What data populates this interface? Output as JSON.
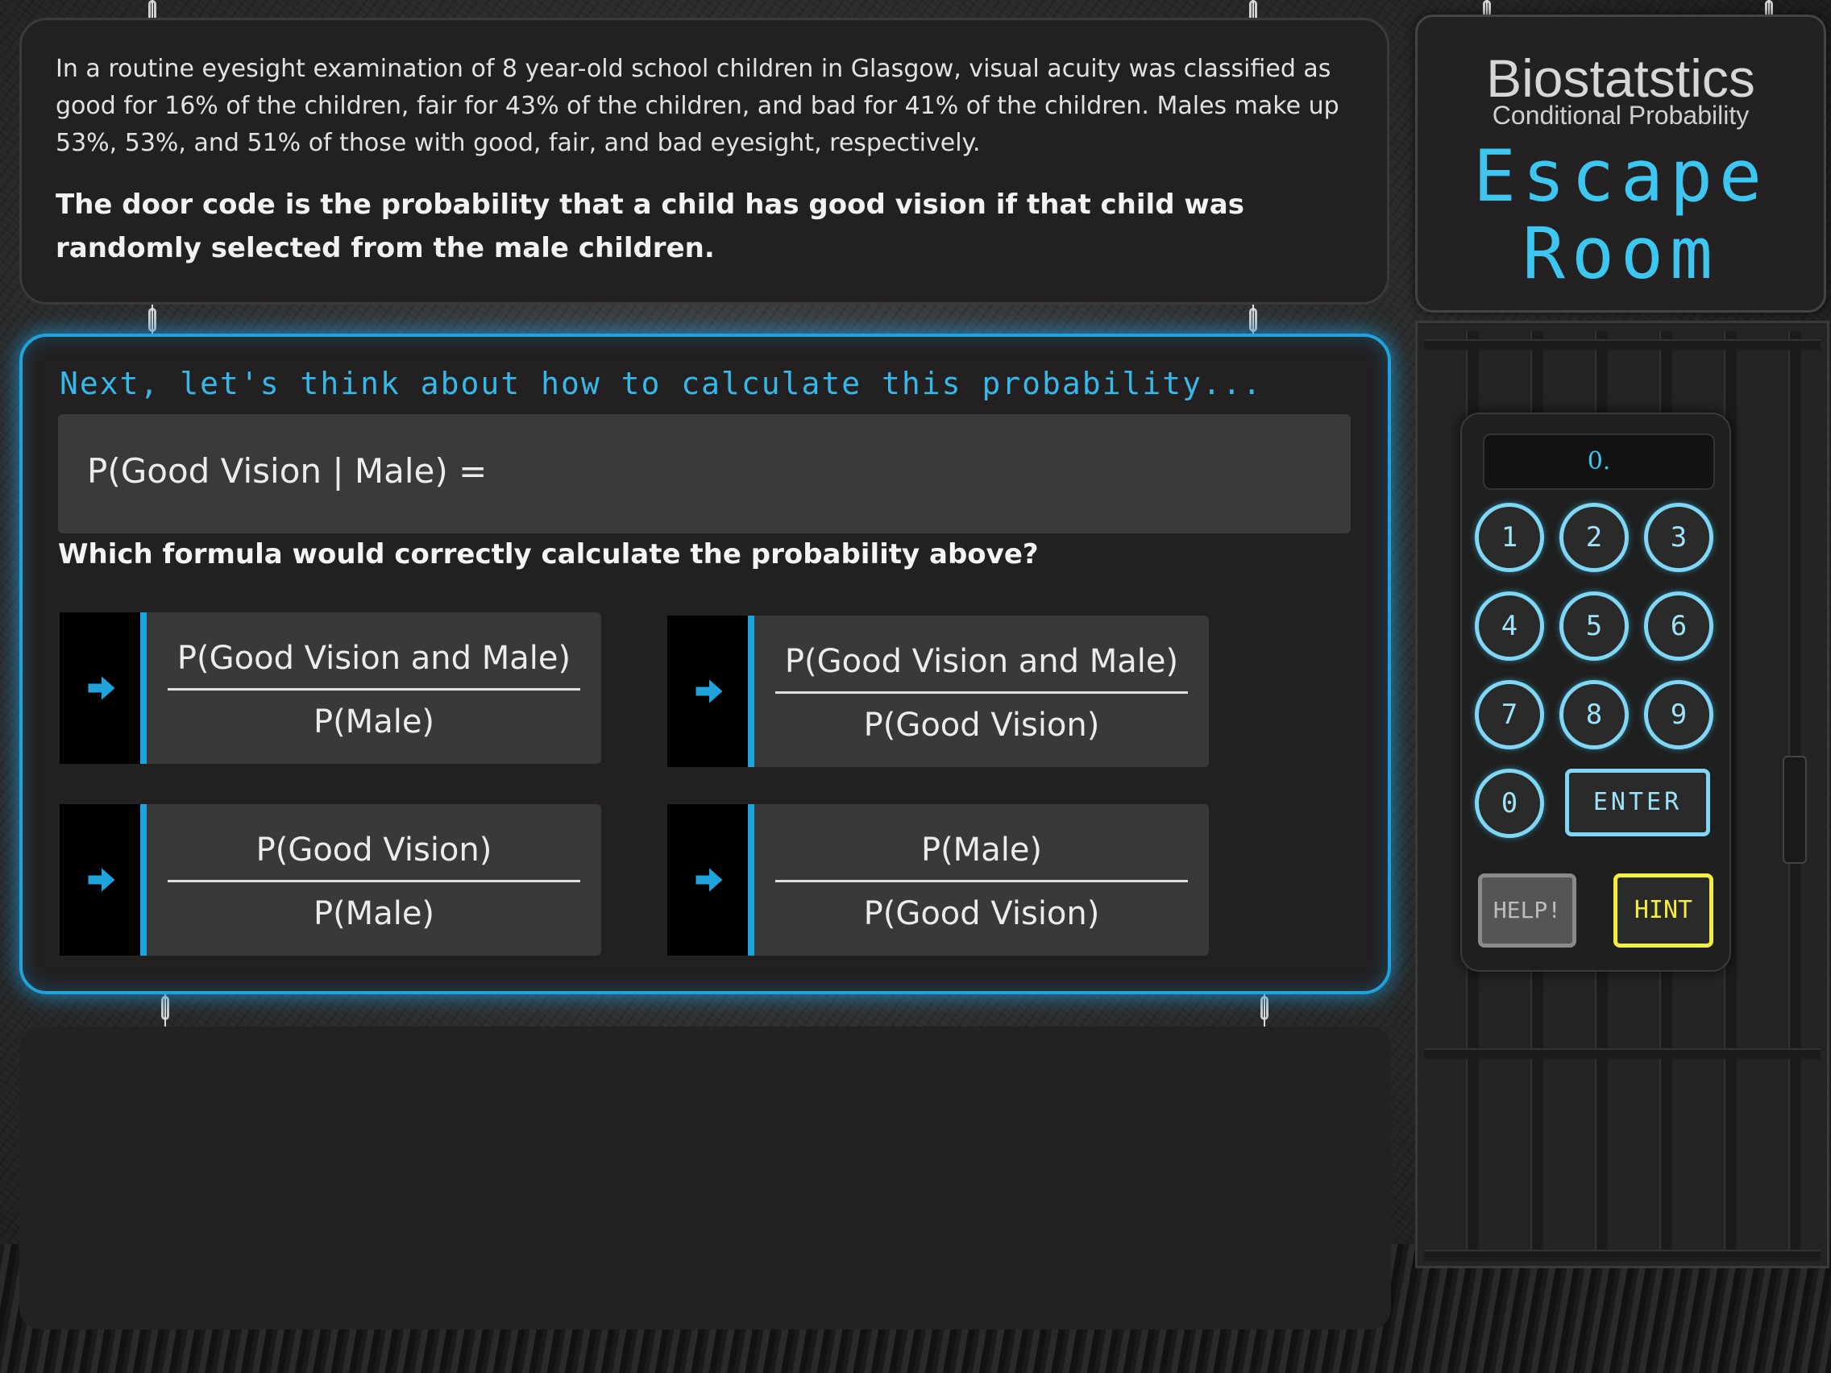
{
  "problem": {
    "paragraph": "In a routine eyesight examination of 8 year-old school children in Glasgow, visual acuity was classified as good for 16% of the children, fair for 43% of the children, and bad for 41% of the children. Males make up 53%, 53%, and 51% of those with good, fair, and bad eyesight, respectively.",
    "task": "The door code is the probability that a child has good vision if that child was randomly selected from the male children."
  },
  "question": {
    "prompt": "Next, let's think about how to calculate this probability...",
    "expression": "P(Good Vision | Male) =",
    "text": "Which formula would correctly calculate the probability above?",
    "options": [
      {
        "numerator": "P(Good Vision and Male)",
        "denominator": "P(Male)"
      },
      {
        "numerator": "P(Good Vision and Male)",
        "denominator": "P(Good Vision)"
      },
      {
        "numerator": "P(Good Vision)",
        "denominator": "P(Male)"
      },
      {
        "numerator": "P(Male)",
        "denominator": "P(Good Vision)"
      }
    ],
    "arrow_icon": "arrow-right-icon"
  },
  "title": {
    "line1": "Biostatstics",
    "line2": "Conditional Probability",
    "line3a": "Escape",
    "line3b": "Room"
  },
  "keypad": {
    "display": "0.",
    "keys": [
      "1",
      "2",
      "3",
      "4",
      "5",
      "6",
      "7",
      "8",
      "9",
      "0"
    ],
    "enter": "ENTER",
    "help": "HELP!",
    "hint": "HINT"
  },
  "colors": {
    "accent": "#1fa3dc",
    "hint": "#f4ee3c"
  }
}
